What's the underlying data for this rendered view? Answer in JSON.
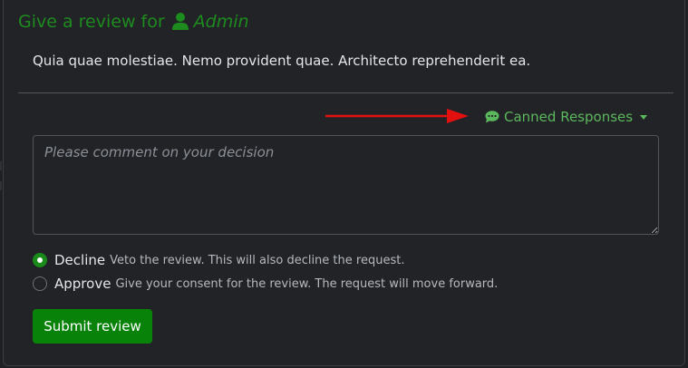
{
  "review": {
    "title_prefix": "Give a review for",
    "user_name": "Admin",
    "summary": "Quia quae molestiae. Nemo provident quae. Architecto reprehenderit ea.",
    "canned_label": "Canned Responses",
    "comment_placeholder": "Please comment on your decision",
    "comment_value": "",
    "options": [
      {
        "label": "Decline",
        "description": "Veto the review. This will also decline the request.",
        "selected": true
      },
      {
        "label": "Approve",
        "description": "Give your consent for the review. The request will move forward.",
        "selected": false
      }
    ],
    "submit_label": "Submit review"
  },
  "colors": {
    "accent_green": "#1e8b1e",
    "link_green": "#5cb85c",
    "button_green": "#088208",
    "arrow_red": "#e31010",
    "background": "#212327"
  },
  "icons": {
    "user": "user-icon",
    "canned": "chat-icon",
    "dropdown": "caret-down-icon"
  }
}
